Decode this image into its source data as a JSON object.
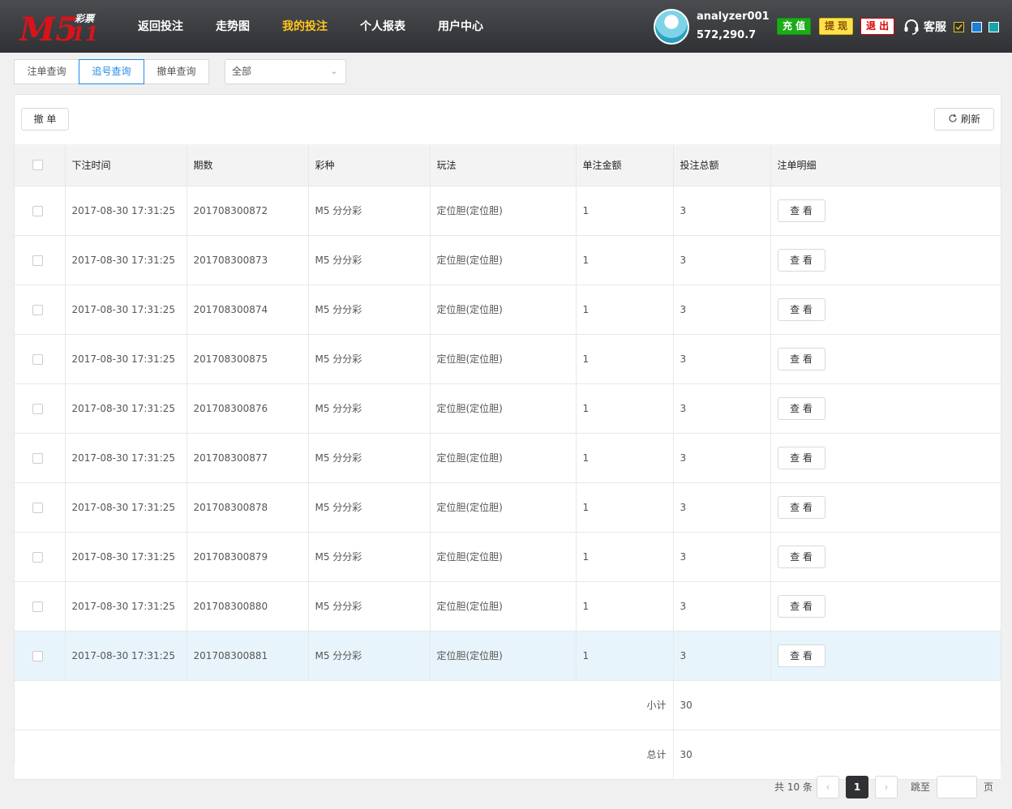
{
  "header": {
    "logo": {
      "brand": "M5",
      "sub": "彩票",
      "num": "11"
    },
    "nav": [
      "返回投注",
      "走势图",
      "我的投注",
      "个人报表",
      "用户中心"
    ],
    "active_nav": 2,
    "username": "analyzer001",
    "balance": "572,290.7",
    "charge_label": "充 值",
    "withdraw_label": "提 现",
    "logout_label": "退 出",
    "service_label": "客服",
    "theme_colors": [
      "#2f3134",
      "#1b7fd6",
      "#1aa3a8"
    ]
  },
  "tabs": [
    "注单查询",
    "追号查询",
    "撤单查询"
  ],
  "active_tab": 1,
  "filter": {
    "selected": "全部"
  },
  "toolbar": {
    "cancel_label": "撤 单",
    "refresh_label": "刷新"
  },
  "table": {
    "columns": [
      "下注时间",
      "期数",
      "彩种",
      "玩法",
      "单注金额",
      "投注总额",
      "注单明细"
    ],
    "rows": [
      {
        "time": "2017-08-30 17:31:25",
        "period": "201708300872",
        "lottery": "M5 分分彩",
        "play": "定位胆(定位胆)",
        "unit": "1",
        "total": "3",
        "detail": "查 看"
      },
      {
        "time": "2017-08-30 17:31:25",
        "period": "201708300873",
        "lottery": "M5 分分彩",
        "play": "定位胆(定位胆)",
        "unit": "1",
        "total": "3",
        "detail": "查 看"
      },
      {
        "time": "2017-08-30 17:31:25",
        "period": "201708300874",
        "lottery": "M5 分分彩",
        "play": "定位胆(定位胆)",
        "unit": "1",
        "total": "3",
        "detail": "查 看"
      },
      {
        "time": "2017-08-30 17:31:25",
        "period": "201708300875",
        "lottery": "M5 分分彩",
        "play": "定位胆(定位胆)",
        "unit": "1",
        "total": "3",
        "detail": "查 看"
      },
      {
        "time": "2017-08-30 17:31:25",
        "period": "201708300876",
        "lottery": "M5 分分彩",
        "play": "定位胆(定位胆)",
        "unit": "1",
        "total": "3",
        "detail": "查 看"
      },
      {
        "time": "2017-08-30 17:31:25",
        "period": "201708300877",
        "lottery": "M5 分分彩",
        "play": "定位胆(定位胆)",
        "unit": "1",
        "total": "3",
        "detail": "查 看"
      },
      {
        "time": "2017-08-30 17:31:25",
        "period": "201708300878",
        "lottery": "M5 分分彩",
        "play": "定位胆(定位胆)",
        "unit": "1",
        "total": "3",
        "detail": "查 看"
      },
      {
        "time": "2017-08-30 17:31:25",
        "period": "201708300879",
        "lottery": "M5 分分彩",
        "play": "定位胆(定位胆)",
        "unit": "1",
        "total": "3",
        "detail": "查 看"
      },
      {
        "time": "2017-08-30 17:31:25",
        "period": "201708300880",
        "lottery": "M5 分分彩",
        "play": "定位胆(定位胆)",
        "unit": "1",
        "total": "3",
        "detail": "查 看"
      },
      {
        "time": "2017-08-30 17:31:25",
        "period": "201708300881",
        "lottery": "M5 分分彩",
        "play": "定位胆(定位胆)",
        "unit": "1",
        "total": "3",
        "detail": "查 看"
      }
    ],
    "highlighted_row": 9,
    "subtotal_label": "小计",
    "subtotal_value": "30",
    "total_label": "总计",
    "total_value": "30"
  },
  "pagination": {
    "total_text": "共 10 条",
    "current_page": "1",
    "prev": "‹",
    "next": "›",
    "jump_label": "跳至",
    "page_suffix": "页"
  }
}
